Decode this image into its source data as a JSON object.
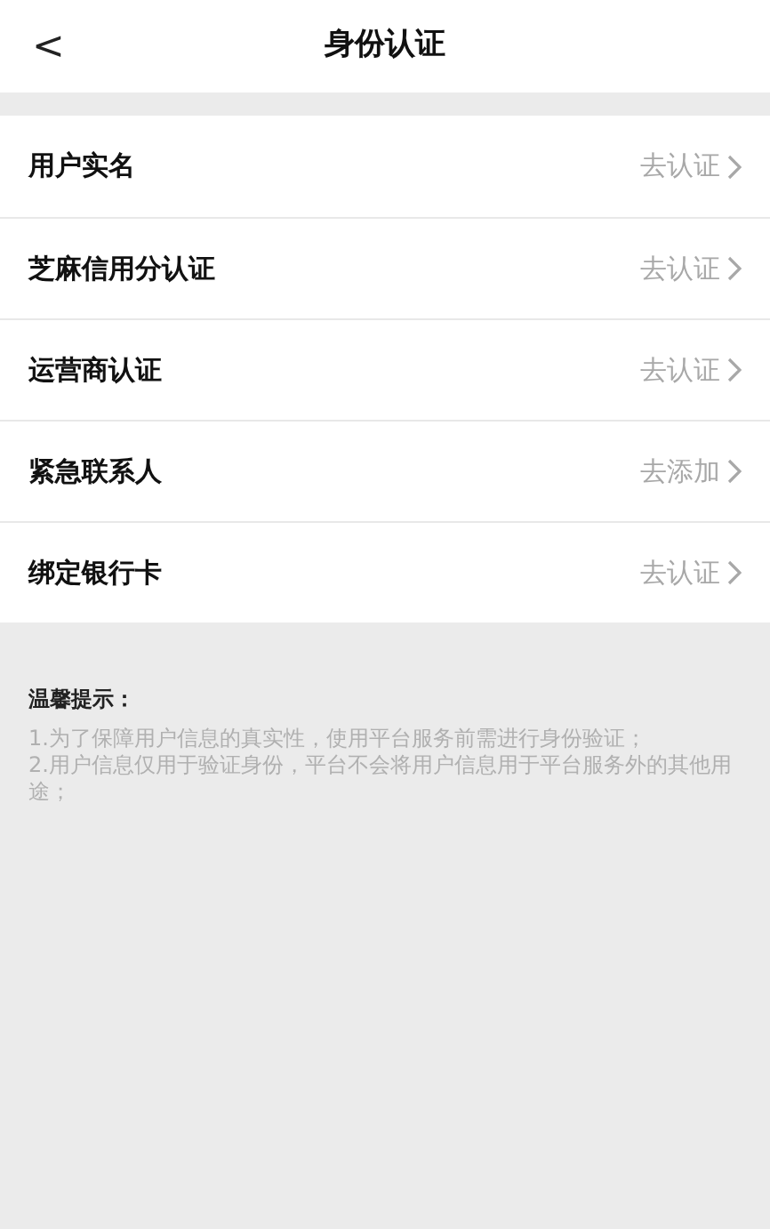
{
  "header": {
    "back": "<",
    "title": "身份认证"
  },
  "items": [
    {
      "label": "用户实名",
      "action": "去认证"
    },
    {
      "label": "芝麻信用分认证",
      "action": "去认证"
    },
    {
      "label": "运营商认证",
      "action": "去认证"
    },
    {
      "label": "紧急联系人",
      "action": "去添加"
    },
    {
      "label": "绑定银行卡",
      "action": "去认证"
    }
  ],
  "tips": {
    "title": "温馨提示：",
    "lines": [
      "1.为了保障用户信息的真实性，使用平台服务前需进行身份验证；",
      "2.用户信息仅用于验证身份，平台不会将用户信息用于平台服务外的其他用途；"
    ]
  }
}
